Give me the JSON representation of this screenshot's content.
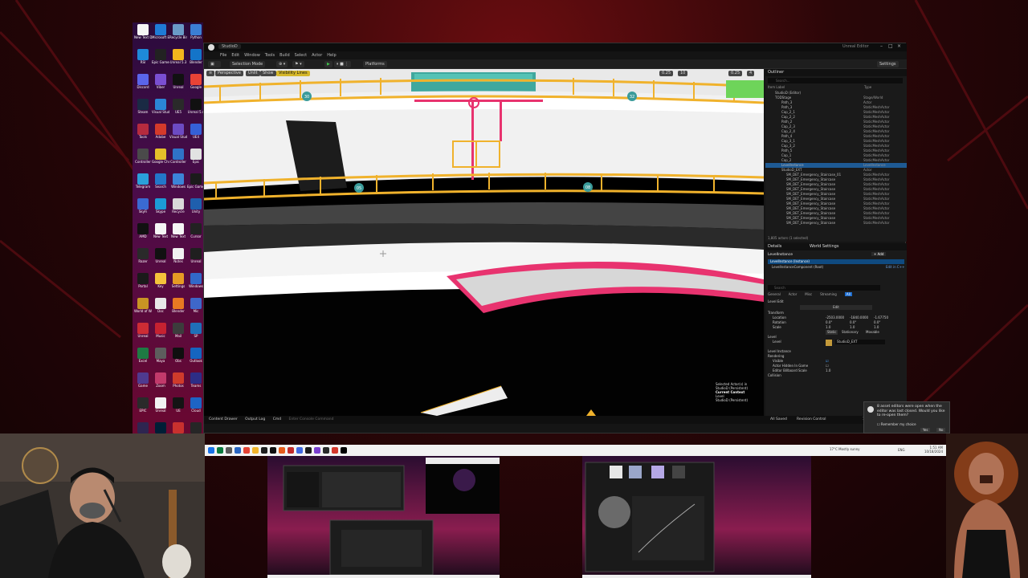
{
  "desktop": {
    "icons": [
      {
        "label": "New Text Document",
        "color": "#f5f5f5"
      },
      {
        "label": "Microsoft Edge",
        "color": "#1f7bd6"
      },
      {
        "label": "Recycle Bin",
        "color": "#6a9bc7"
      },
      {
        "label": "Python",
        "color": "#3b7fd4"
      },
      {
        "label": "RSI",
        "color": "#1e8ad9"
      },
      {
        "label": "Epic Games",
        "color": "#222"
      },
      {
        "label": "Unreal 5.3",
        "color": "#f2b61d"
      },
      {
        "label": "Blender",
        "color": "#1474c9"
      },
      {
        "label": "Discord",
        "color": "#5a65ea"
      },
      {
        "label": "Viber",
        "color": "#7a4fd1"
      },
      {
        "label": "Unreal",
        "color": "#111"
      },
      {
        "label": "Google",
        "color": "#e84336"
      },
      {
        "label": "Steam",
        "color": "#1a2a44"
      },
      {
        "label": "Visual Studio Code",
        "color": "#2b86d6"
      },
      {
        "label": "UE5",
        "color": "#2a2a2a"
      },
      {
        "label": "Unreal 5.4",
        "color": "#111"
      },
      {
        "label": "Tools",
        "color": "#b52b3e"
      },
      {
        "label": "Adobe",
        "color": "#d33a2b"
      },
      {
        "label": "Visual Studio",
        "color": "#6c4bc2"
      },
      {
        "label": "UE4",
        "color": "#3560d8"
      },
      {
        "label": "Controller",
        "color": "#4a4a4a"
      },
      {
        "label": "Google Chrome",
        "color": "#e5bf2a"
      },
      {
        "label": "Controller",
        "color": "#2f73c7"
      },
      {
        "label": "Epic",
        "color": "#e2e2e2"
      },
      {
        "label": "Telegram",
        "color": "#2aa0da"
      },
      {
        "label": "Search",
        "color": "#2377c9"
      },
      {
        "label": "Windows",
        "color": "#3c84d8"
      },
      {
        "label": "Epic Games",
        "color": "#1b1b1b"
      },
      {
        "label": "SkyFi",
        "color": "#3a6ad2"
      },
      {
        "label": "Skype",
        "color": "#1c9ad6"
      },
      {
        "label": "Recycle",
        "color": "#d9d9d9"
      },
      {
        "label": "Unity",
        "color": "#1f5fad"
      },
      {
        "label": "AMD",
        "color": "#111"
      },
      {
        "label": "New Text",
        "color": "#f5f5f5"
      },
      {
        "label": "New Text",
        "color": "#f5f5f5"
      },
      {
        "label": "Cursor",
        "color": "#222"
      },
      {
        "label": "Razer",
        "color": "#2a2a2a"
      },
      {
        "label": "Unreal",
        "color": "#111"
      },
      {
        "label": "Notes",
        "color": "#f1f1f1"
      },
      {
        "label": "Unreal",
        "color": "#1f1f1f"
      },
      {
        "label": "Portal",
        "color": "#1a1a1a"
      },
      {
        "label": "Key",
        "color": "#f4c23b"
      },
      {
        "label": "Settings",
        "color": "#e69a24"
      },
      {
        "label": "Windows",
        "color": "#3268c9"
      },
      {
        "label": "World of Warcraft",
        "color": "#c89424"
      },
      {
        "label": "Doc",
        "color": "#e8e8e8"
      },
      {
        "label": "Blender",
        "color": "#e87a22"
      },
      {
        "label": "Mic",
        "color": "#3e67c9"
      },
      {
        "label": "Unreal",
        "color": "#cc2c34"
      },
      {
        "label": "Music",
        "color": "#c52231"
      },
      {
        "label": "Mail",
        "color": "#3c3c3c"
      },
      {
        "label": "SP",
        "color": "#1f6fb8"
      },
      {
        "label": "Excel",
        "color": "#1e7a43"
      },
      {
        "label": "Maya",
        "color": "#5d5d5d"
      },
      {
        "label": "Obs",
        "color": "#0f0f0f"
      },
      {
        "label": "Outlook",
        "color": "#1565c0"
      },
      {
        "label": "Game",
        "color": "#4f3a8f"
      },
      {
        "label": "Zoom",
        "color": "#c23a6b"
      },
      {
        "label": "Photos",
        "color": "#cf3b2b"
      },
      {
        "label": "Teams",
        "color": "#2d2d86"
      },
      {
        "label": "EPIC",
        "color": "#2a2a2a"
      },
      {
        "label": "Unreal",
        "color": "#f2f2f2"
      },
      {
        "label": "UE",
        "color": "#141414"
      },
      {
        "label": "Cloud",
        "color": "#1d64c4"
      },
      {
        "label": "Photoshop",
        "color": "#2e2550"
      },
      {
        "label": "Ps",
        "color": "#001e36"
      },
      {
        "label": "Retro",
        "color": "#c8312e"
      },
      {
        "label": "Util",
        "color": "#262626"
      },
      {
        "label": "Meta",
        "color": "#1a73e8"
      },
      {
        "label": "Vivaldi",
        "color": "#ef3939"
      },
      {
        "label": "Discord",
        "color": "#5865f2"
      },
      {
        "label": "Note",
        "color": "#cc2a2a"
      }
    ]
  },
  "ue": {
    "title": "Unreal Editor",
    "level_tab": "StudioD",
    "menu": [
      "File",
      "Edit",
      "Window",
      "Tools",
      "Build",
      "Select",
      "Actor",
      "Help"
    ],
    "toolbar": {
      "mode": "Selection Mode",
      "platforms": "Platforms",
      "settings": "Settings"
    },
    "viewport": {
      "buttons": [
        "Perspective",
        "Unlit",
        "Show",
        "Visibility Lines"
      ],
      "stats": [
        "0.25",
        "10",
        "0.25",
        "4"
      ],
      "overlay": {
        "line1": "Selected Actor(s) in",
        "line2": "StudioD (Persistent)",
        "line3": "Current Context",
        "line4": "Level",
        "line5": "StudioD (Persistent)"
      },
      "sign_numbers": [
        "30",
        "32",
        "05",
        "08"
      ]
    },
    "outliner": {
      "title": "Outliner",
      "search_placeholder": "Search...",
      "col_label": "Item Label",
      "col_type": "Type",
      "rows": [
        {
          "label": "StudioD (Editor)",
          "type": ""
        },
        {
          "label": "TODStage",
          "type": "Stage/World"
        },
        {
          "label": "Path_3",
          "type": "Actor"
        },
        {
          "label": "Path_3",
          "type": "StaticMeshActor"
        },
        {
          "label": "Cap_2_1",
          "type": "StaticMeshActor"
        },
        {
          "label": "Cap_2_2",
          "type": "StaticMeshActor"
        },
        {
          "label": "Path_2",
          "type": "StaticMeshActor"
        },
        {
          "label": "Cap_2_3",
          "type": "StaticMeshActor"
        },
        {
          "label": "Cap_2_4",
          "type": "StaticMeshActor"
        },
        {
          "label": "Path_4",
          "type": "StaticMeshActor"
        },
        {
          "label": "Cap_3_1",
          "type": "StaticMeshActor"
        },
        {
          "label": "Cap_3_2",
          "type": "StaticMeshActor"
        },
        {
          "label": "Path_5",
          "type": "StaticMeshActor"
        },
        {
          "label": "Cap_1",
          "type": "StaticMeshActor"
        },
        {
          "label": "Cap_2",
          "type": "StaticMeshActor"
        },
        {
          "label": "LevelInstance",
          "type": "LevelInstance"
        },
        {
          "label": "StudioD_EXT",
          "type": "Actor"
        },
        {
          "label": "SM_DET_Emergency_Staircase_01",
          "type": "StaticMeshActor"
        },
        {
          "label": "SM_DET_Emergency_Staircase",
          "type": "StaticMeshActor"
        },
        {
          "label": "SM_DET_Emergency_Staircase",
          "type": "StaticMeshActor"
        },
        {
          "label": "SM_DET_Emergency_Staircase",
          "type": "StaticMeshActor"
        },
        {
          "label": "SM_DET_Emergency_Staircase",
          "type": "StaticMeshActor"
        },
        {
          "label": "SM_DET_Emergency_Staircase",
          "type": "StaticMeshActor"
        },
        {
          "label": "SM_DET_Emergency_Staircase",
          "type": "StaticMeshActor"
        },
        {
          "label": "SM_DET_Emergency_Staircase",
          "type": "StaticMeshActor"
        },
        {
          "label": "SM_DET_Emergency_Staircase",
          "type": "StaticMeshActor"
        },
        {
          "label": "SM_DET_Emergency_Staircase",
          "type": "StaticMeshActor"
        },
        {
          "label": "SM_DET_Emergency_Staircase",
          "type": "StaticMeshActor"
        }
      ],
      "footer": "1,805 actors (1 selected)"
    },
    "details": {
      "tabs": [
        "Details",
        "World Settings"
      ],
      "actor": "LevelInstance",
      "add": "+ Add",
      "component_root": "LevelInstance (Instance)",
      "component_child": "LevelInstanceComponent (Root)",
      "edit_link": "Edit in C++",
      "search_placeholder": "Search",
      "filters": [
        "General",
        "Actor",
        "Misc",
        "Streaming",
        "All"
      ],
      "sections": {
        "level_edit": "Level Edit",
        "edit": "Edit",
        "transform": "Transform",
        "location": "Location",
        "rotation": "Rotation",
        "scale": "Scale",
        "level": "Level",
        "level_label": "Level",
        "level_instance": "Level Instance",
        "rendering": "Rendering",
        "visible": "Visible",
        "hidden_in_game": "Actor Hidden In Game",
        "billboard": "Editor Billboard Scale",
        "collision": "Collision"
      },
      "values": {
        "loc": [
          "-2503.0000",
          "-1840.0000",
          "-1.67750"
        ],
        "rot": [
          "0.0°",
          "0.0°",
          "0.0°"
        ],
        "scale": [
          "1.0",
          "1.0",
          "1.0"
        ],
        "mobility": [
          "Static",
          "Stationary",
          "Movable"
        ],
        "billboard": "1.0",
        "level_asset": "StudioD_EXT"
      }
    },
    "bottombar": [
      "Content Drawer",
      "Output Log",
      "Cmd",
      "Enter Console Command"
    ],
    "status_right": [
      "All Saved",
      "Revision Control",
      "1 Unsaved"
    ]
  },
  "notification": {
    "text": "8 asset editors were open when the editor was last closed. Would you like to re-open them?",
    "checkbox": "Remember my choice",
    "yes": "Yes",
    "no": "No"
  },
  "taskbar": {
    "icons": [
      "#1a73e8",
      "#0b7a3e",
      "#5a5a5a",
      "#2b66c2",
      "#e34234",
      "#f0b32a",
      "#1f1f1f",
      "#0f0f0f",
      "#e65c1c",
      "#c22b2b",
      "#4169e1",
      "#1c1c1c",
      "#7a3fcf",
      "#2a2a2a",
      "#d4372c",
      "#000000"
    ],
    "weather": "17°C  Mostly sunny",
    "lang": "ENG",
    "time": "1:51 AM",
    "date": "10/18/2024"
  }
}
